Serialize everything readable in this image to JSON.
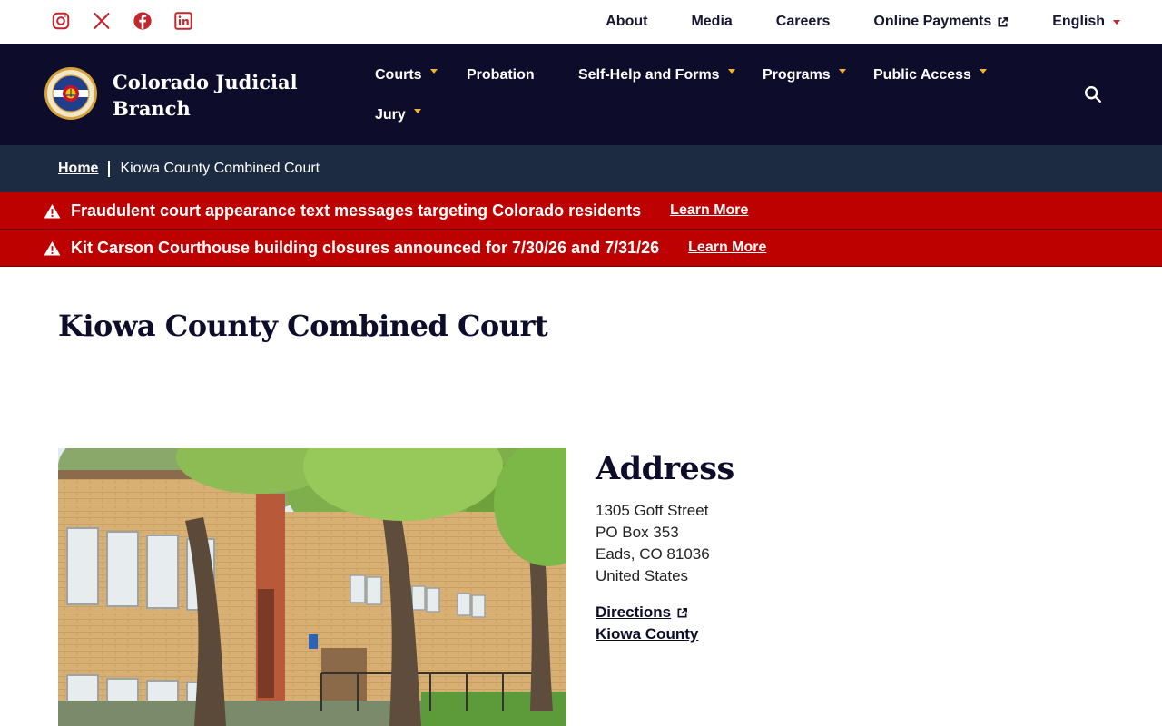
{
  "utility": {
    "social": [
      {
        "name": "instagram-icon"
      },
      {
        "name": "x-icon"
      },
      {
        "name": "facebook-icon"
      },
      {
        "name": "linkedin-icon"
      }
    ],
    "links": {
      "about": "About",
      "media": "Media",
      "careers": "Careers",
      "payments": "Online Payments",
      "language": "English"
    }
  },
  "brand": {
    "name_line1": "Colorado Judicial",
    "name_line2": "Branch"
  },
  "nav": {
    "courts": "Courts",
    "probation": "Probation",
    "self_help": "Self-Help and Forms",
    "programs": "Programs",
    "public_access": "Public Access",
    "jury": "Jury"
  },
  "breadcrumb": {
    "home": "Home",
    "current": "Kiowa County Combined Court"
  },
  "alerts": [
    {
      "message": "Fraudulent court appearance text messages targeting Colorado residents",
      "link": "Learn More"
    },
    {
      "message": "Kit Carson Courthouse building closures announced for 7/30/26 and 7/31/26",
      "link": "Learn More"
    }
  ],
  "page": {
    "title": "Kiowa County Combined Court"
  },
  "address": {
    "heading": "Address",
    "street": "1305 Goff Street",
    "po_box": "PO Box 353",
    "city": "Eads, CO 81036",
    "country": "United States",
    "directions": "Directions",
    "county": "Kiowa County"
  },
  "colors": {
    "nav_bg": "#0d0c2b",
    "breadcrumb_bg": "#1c2b41",
    "alert_bg": "#bd0000",
    "accent_red": "#c2272d",
    "accent_gold": "#f5b335"
  }
}
